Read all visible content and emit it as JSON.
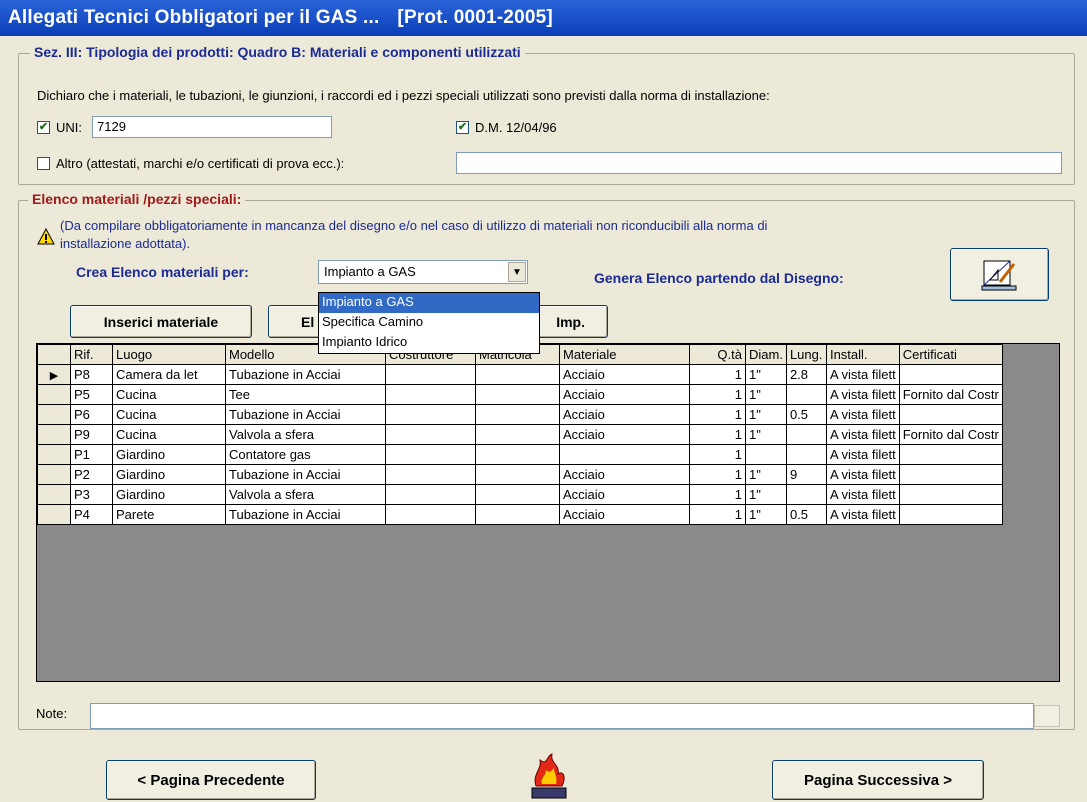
{
  "window": {
    "title": "Allegati Tecnici Obbligatori per il GAS ...",
    "prot": "[Prot.  0001-2005]"
  },
  "section": {
    "legend": "Sez. III: Tipologia dei prodotti:  Quadro B:  Materiali e componenti utilizzati",
    "declaration": "Dichiaro che i materiali, le tubazioni, le giunzioni, i raccordi ed i pezzi speciali utilizzati sono previsti dalla norma di installazione:",
    "uni": {
      "label": "UNI:",
      "value": "7129",
      "checked": true
    },
    "dm": {
      "label": "D.M. 12/04/96",
      "checked": true
    },
    "altro": {
      "label": "Altro (attestati, marchi e/o certificati di prova ecc.):",
      "value": "",
      "checked": false
    }
  },
  "elenco": {
    "legend": "Elenco materiali /pezzi speciali:",
    "note_line1": "(Da compilare obbligatoriamente in mancanza del disegno e/o nel caso di utilizzo di materiali non riconducibili alla norma di",
    "note_line2": "installazione adottata).",
    "crea_label": "Crea Elenco materiali per:",
    "crea_value": "Impianto a GAS",
    "genera_label": "Genera Elenco partendo dal Disegno:",
    "dropdown_options": [
      "Impianto a GAS",
      "Specifica Camino",
      "Impianto Idrico"
    ],
    "btn_inserisci": "Inserici materiale",
    "btn_elimina_partial": "El",
    "btn_imp_partial": "Imp."
  },
  "table": {
    "columns": [
      "Rif.",
      "Luogo",
      "Modello",
      "Costruttore",
      "Matricola",
      "Materiale",
      "Q.tà",
      "Diam.",
      "Lung.",
      "Install.",
      "Certificati"
    ],
    "rows": [
      [
        "P8",
        "Camera da let",
        "Tubazione in Acciai",
        "",
        "",
        "Acciaio",
        "1",
        "1\"",
        "2.8",
        "A vista filett",
        ""
      ],
      [
        "P5",
        "Cucina",
        "Tee",
        "",
        "",
        "Acciaio",
        "1",
        "1\"",
        "",
        "A vista filett",
        "Fornito dal Costr"
      ],
      [
        "P6",
        "Cucina",
        "Tubazione in Acciai",
        "",
        "",
        "Acciaio",
        "1",
        "1\"",
        "0.5",
        "A vista filett",
        ""
      ],
      [
        "P9",
        "Cucina",
        "Valvola a sfera",
        "",
        "",
        "Acciaio",
        "1",
        "1\"",
        "",
        "A vista filett",
        "Fornito dal Costr"
      ],
      [
        "P1",
        "Giardino",
        "Contatore gas",
        "",
        "",
        "",
        "1",
        "",
        "",
        "A vista filett",
        ""
      ],
      [
        "P2",
        "Giardino",
        "Tubazione in Acciai",
        "",
        "",
        "Acciaio",
        "1",
        "1\"",
        "9",
        "A vista filett",
        ""
      ],
      [
        "P3",
        "Giardino",
        "Valvola a sfera",
        "",
        "",
        "Acciaio",
        "1",
        "1\"",
        "",
        "A vista filett",
        ""
      ],
      [
        "P4",
        "Parete",
        "Tubazione in Acciai",
        "",
        "",
        "Acciaio",
        "1",
        "1\"",
        "0.5",
        "A vista filett",
        ""
      ]
    ]
  },
  "note": {
    "label": "Note:",
    "value": ""
  },
  "nav": {
    "prev": "< Pagina Precedente",
    "next": "Pagina Successiva >"
  },
  "colors": {
    "title_bg": "#0a3fb8",
    "dialog_bg": "#ece9d8",
    "selection": "#316ac5",
    "label_blue": "#1b2b93",
    "label_red": "#a11a1a"
  }
}
